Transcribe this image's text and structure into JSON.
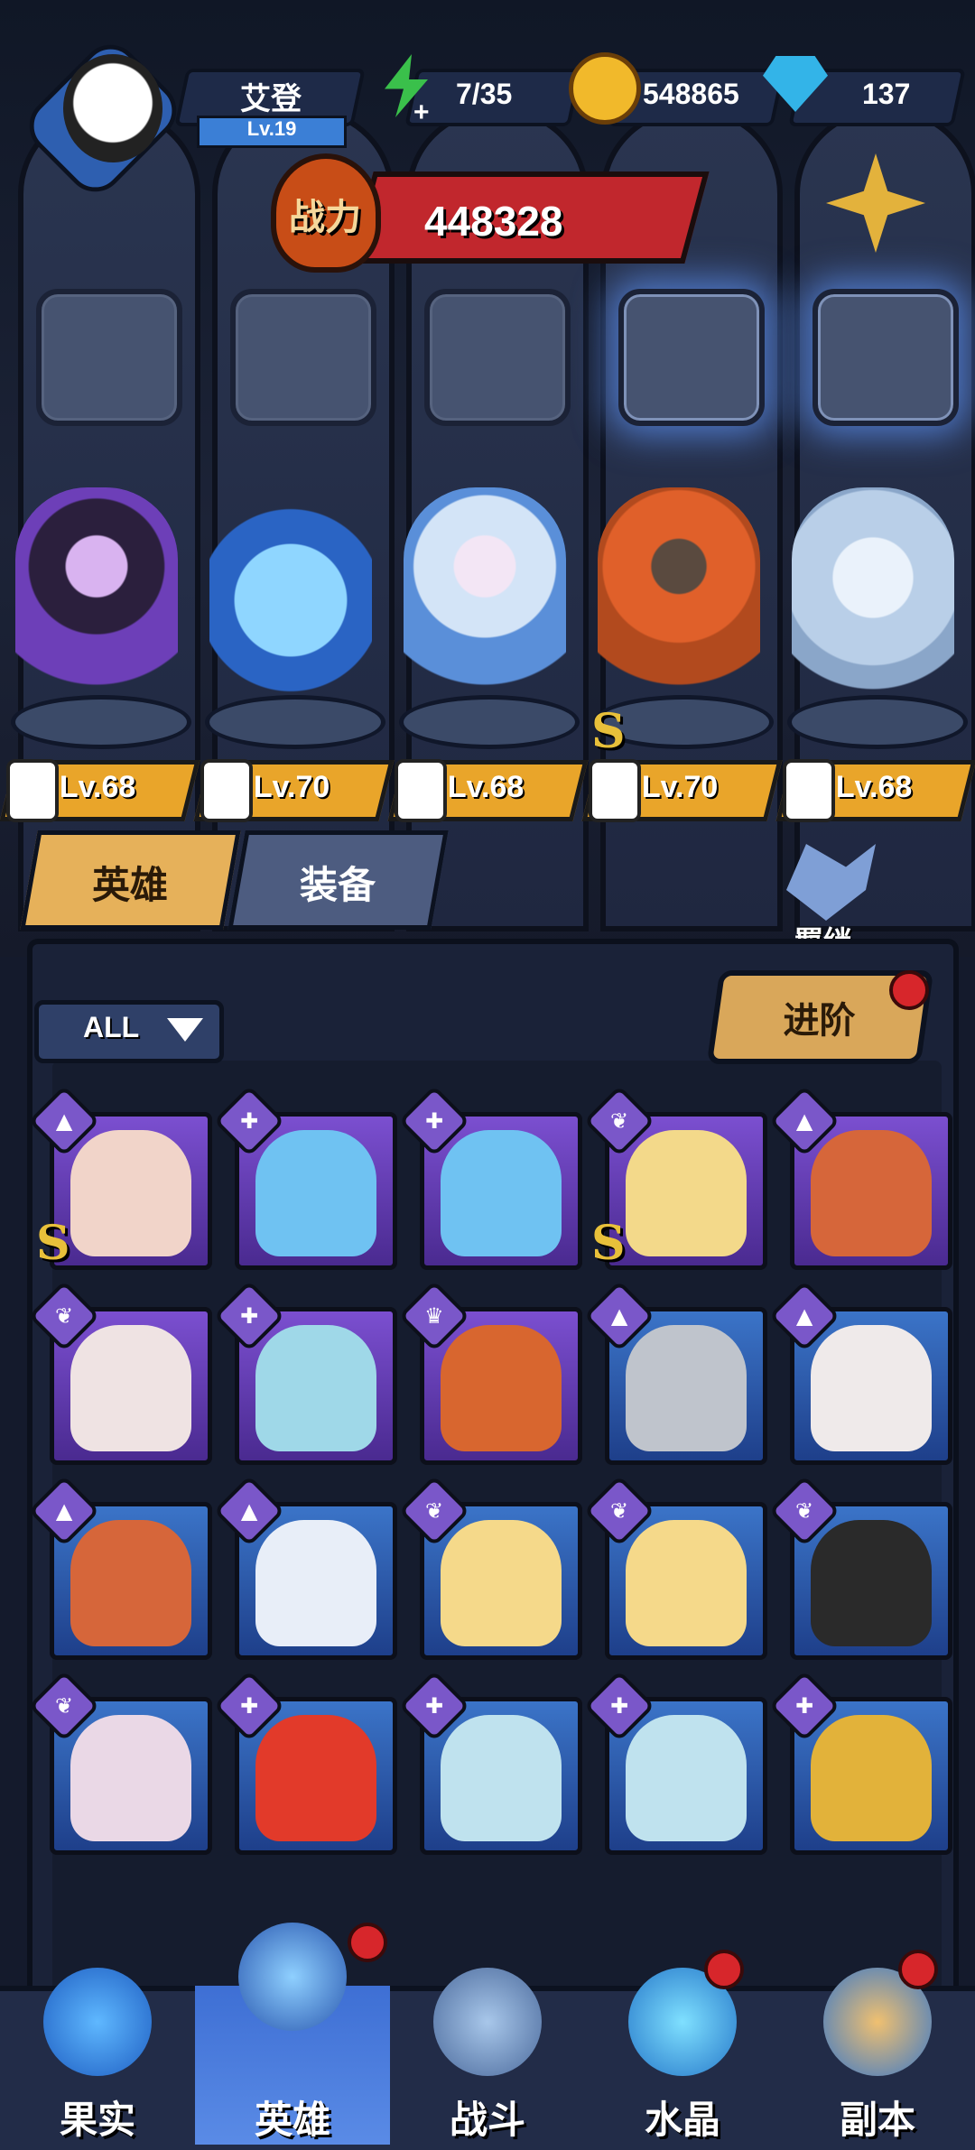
{
  "header": {
    "player_name": "艾登",
    "player_level": "Lv.19",
    "stamina": "7/35",
    "gold": "548865",
    "gems": "137"
  },
  "power": {
    "label": "战力",
    "value": "448328"
  },
  "heroes": [
    {
      "level": "Lv.68",
      "name": "sorceress"
    },
    {
      "level": "Lv.70",
      "name": "orb-creature"
    },
    {
      "level": "Lv.68",
      "name": "ice-mage"
    },
    {
      "level": "Lv.70",
      "name": "minotaur"
    },
    {
      "level": "Lv.68",
      "name": "yeti"
    }
  ],
  "tabs": {
    "heroes": "英雄",
    "equipment": "装备"
  },
  "bond": "羁绊",
  "filter": {
    "selected": "ALL"
  },
  "advance_button": "进阶",
  "s_badge": "S",
  "cards": [
    {
      "color": "purple",
      "cls": "▲",
      "s": true
    },
    {
      "color": "purple",
      "cls": "✚",
      "s": false
    },
    {
      "color": "purple",
      "cls": "✚",
      "s": false
    },
    {
      "color": "purple",
      "cls": "❦",
      "s": true
    },
    {
      "color": "purple",
      "cls": "▲",
      "s": false
    },
    {
      "color": "purple",
      "cls": "❦",
      "s": false
    },
    {
      "color": "purple",
      "cls": "✚",
      "s": false
    },
    {
      "color": "purple",
      "cls": "♛",
      "s": false
    },
    {
      "color": "blue",
      "cls": "▲",
      "s": false
    },
    {
      "color": "blue",
      "cls": "▲",
      "s": false
    },
    {
      "color": "blue",
      "cls": "▲",
      "s": false
    },
    {
      "color": "blue",
      "cls": "▲",
      "s": false
    },
    {
      "color": "blue",
      "cls": "❦",
      "s": false
    },
    {
      "color": "blue",
      "cls": "❦",
      "s": false
    },
    {
      "color": "blue",
      "cls": "❦",
      "s": false
    },
    {
      "color": "blue",
      "cls": "❦",
      "s": false
    },
    {
      "color": "blue",
      "cls": "✚",
      "s": false
    },
    {
      "color": "blue",
      "cls": "✚",
      "s": false
    },
    {
      "color": "blue",
      "cls": "✚",
      "s": false
    },
    {
      "color": "blue",
      "cls": "✚",
      "s": false
    }
  ],
  "nav": [
    "果实",
    "英雄",
    "战斗",
    "水晶",
    "副本"
  ],
  "colors": {
    "accent": "#e9a52a",
    "tab_active": "#e6b15a",
    "tab_inactive": "#4d5c80",
    "power_red": "#c1272d"
  }
}
